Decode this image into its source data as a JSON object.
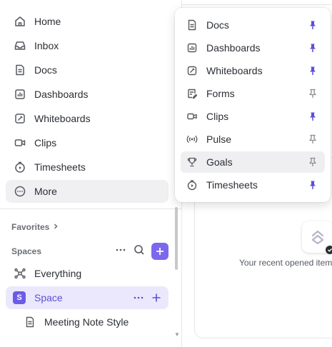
{
  "sidebar": {
    "items": [
      {
        "label": "Home",
        "icon": "home-icon"
      },
      {
        "label": "Inbox",
        "icon": "inbox-icon"
      },
      {
        "label": "Docs",
        "icon": "docs-icon"
      },
      {
        "label": "Dashboards",
        "icon": "dashboards-icon"
      },
      {
        "label": "Whiteboards",
        "icon": "whiteboards-icon"
      },
      {
        "label": "Clips",
        "icon": "clips-icon"
      },
      {
        "label": "Timesheets",
        "icon": "timesheets-icon"
      },
      {
        "label": "More",
        "icon": "more-icon"
      }
    ],
    "favorites_label": "Favorites",
    "spaces_label": "Spaces",
    "everything_label": "Everything",
    "space": {
      "badge": "S",
      "label": "Space"
    },
    "sub_item": "Meeting Note Style"
  },
  "popover": {
    "items": [
      {
        "label": "Docs",
        "icon": "docs-icon",
        "pinned": true
      },
      {
        "label": "Dashboards",
        "icon": "dashboards-icon",
        "pinned": true
      },
      {
        "label": "Whiteboards",
        "icon": "whiteboards-icon",
        "pinned": true
      },
      {
        "label": "Forms",
        "icon": "forms-icon",
        "pinned": false
      },
      {
        "label": "Clips",
        "icon": "clips-icon",
        "pinned": true
      },
      {
        "label": "Pulse",
        "icon": "pulse-icon",
        "pinned": false
      },
      {
        "label": "Goals",
        "icon": "goals-icon",
        "pinned": false
      },
      {
        "label": "Timesheets",
        "icon": "timesheets-icon",
        "pinned": true
      }
    ]
  },
  "main": {
    "recent_text": "Your recent opened items"
  },
  "colors": {
    "accent": "#7b68ee",
    "pinned": "#5b4fd6",
    "unpinned": "#8a8d93"
  }
}
